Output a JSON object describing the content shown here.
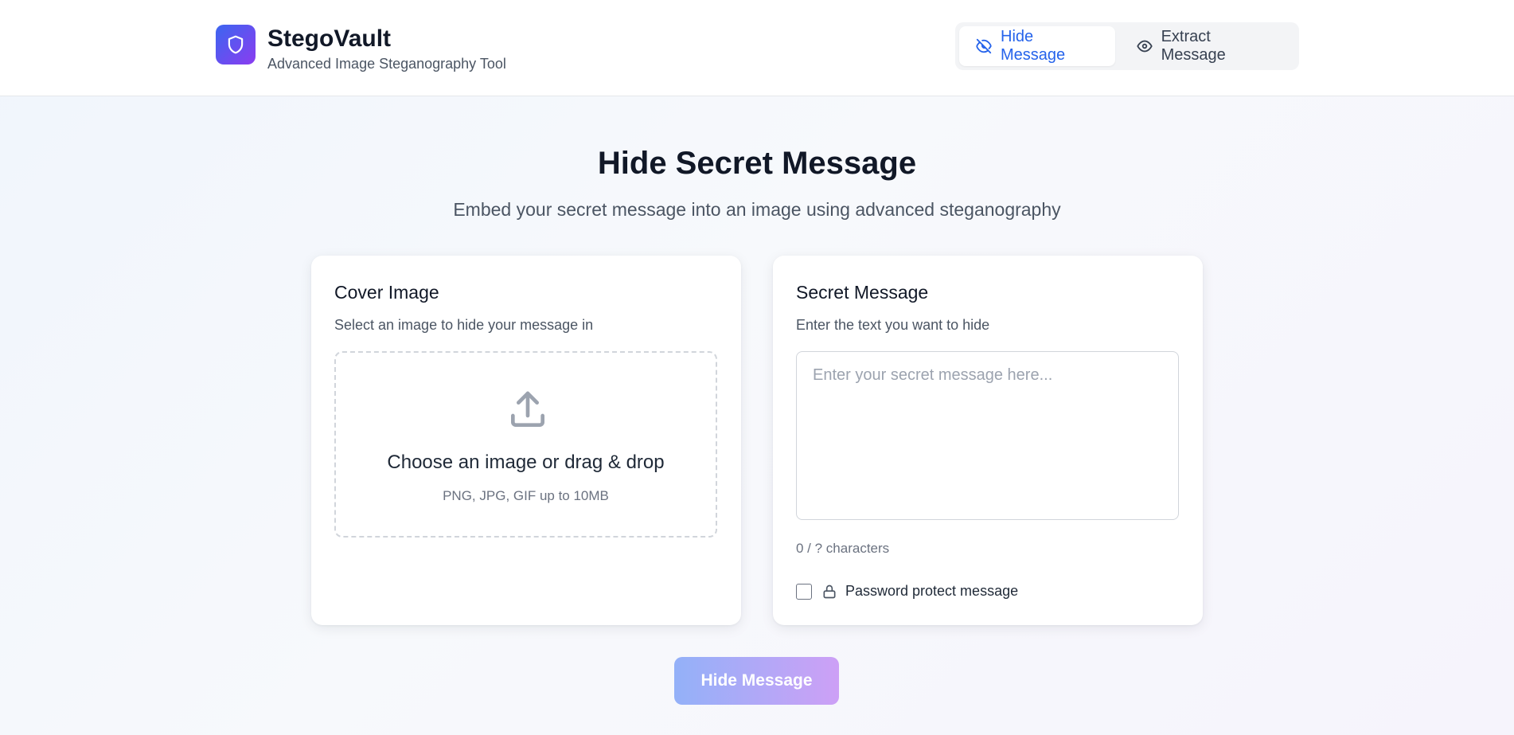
{
  "header": {
    "brand_title": "StegoVault",
    "brand_subtitle": "Advanced Image Steganography Tool",
    "logo_icon": "shield-icon",
    "tabs": [
      {
        "label": "Hide Message",
        "icon": "eye-off-icon",
        "active": true
      },
      {
        "label": "Extract Message",
        "icon": "eye-icon",
        "active": false
      }
    ]
  },
  "hero": {
    "title": "Hide Secret Message",
    "subtitle": "Embed your secret message into an image using advanced steganography"
  },
  "cover_image": {
    "title": "Cover Image",
    "description": "Select an image to hide your message in",
    "dropzone_title": "Choose an image or drag & drop",
    "dropzone_hint": "PNG, JPG, GIF up to 10MB",
    "icon": "upload-icon"
  },
  "secret_message": {
    "title": "Secret Message",
    "description": "Enter the text you want to hide",
    "placeholder": "Enter your secret message here...",
    "value": "",
    "char_count": "0 / ? characters",
    "password_label": "Password protect message",
    "password_checked": false,
    "lock_icon": "lock-icon"
  },
  "actions": {
    "submit_label": "Hide Message"
  },
  "colors": {
    "accent": "#2563eb",
    "logo_gradient_start": "#3b66f0",
    "logo_gradient_end": "#8b3cf0",
    "button_gradient_start": "#93b1f8",
    "button_gradient_end": "#cda0f6"
  }
}
